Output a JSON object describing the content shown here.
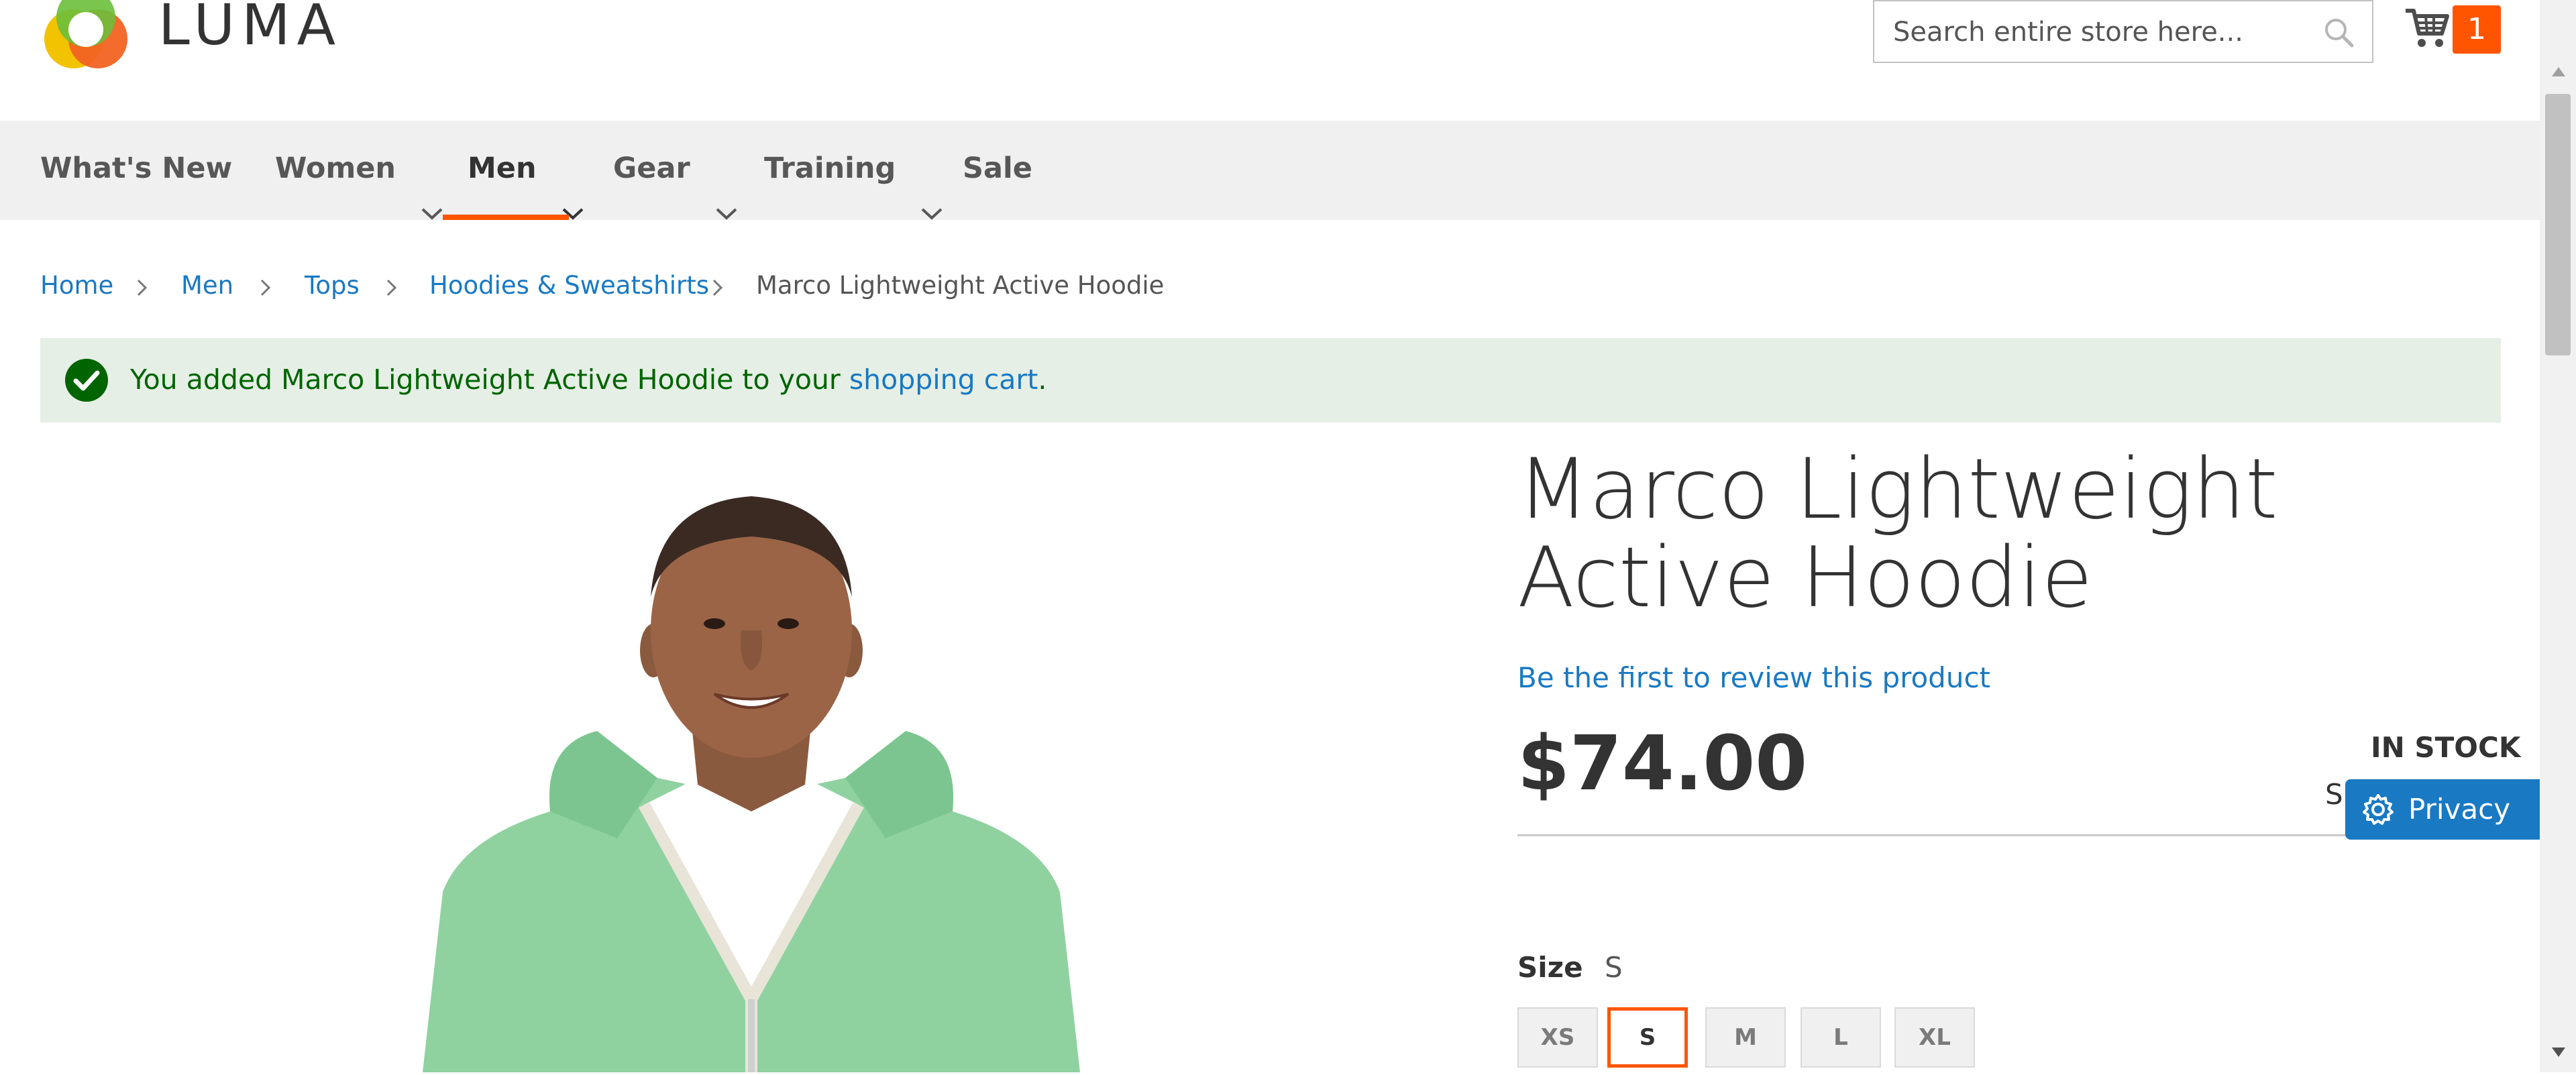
{
  "header": {
    "logo_text": "LUMA",
    "logo_icon": "luma-logo-icon",
    "search": {
      "placeholder": "Search entire store here...",
      "value": ""
    },
    "cart": {
      "icon": "cart-icon",
      "count": "1"
    }
  },
  "nav": {
    "items": [
      {
        "label": "What's New",
        "has_dropdown": false
      },
      {
        "label": "Women",
        "has_dropdown": true
      },
      {
        "label": "Men",
        "has_dropdown": true,
        "active": true
      },
      {
        "label": "Gear",
        "has_dropdown": true
      },
      {
        "label": "Training",
        "has_dropdown": true
      },
      {
        "label": "Sale",
        "has_dropdown": false
      }
    ],
    "accent_color": "#ff5501"
  },
  "breadcrumbs": [
    {
      "label": "Home",
      "link": true
    },
    {
      "label": "Men",
      "link": true
    },
    {
      "label": "Tops",
      "link": true
    },
    {
      "label": "Hoodies & Sweatshirts",
      "link": true
    },
    {
      "label": "Marco Lightweight Active Hoodie",
      "link": false
    }
  ],
  "message": {
    "prefix": "You added Marco Lightweight Active Hoodie to your ",
    "link_text": "shopping cart",
    "suffix": ".",
    "type": "success",
    "color": "#006400",
    "background": "#e5efe5"
  },
  "product": {
    "title": "Marco Lightweight Active Hoodie",
    "review_link": "Be the first to review this product",
    "price": "$74.00",
    "stock": "IN STOCK",
    "sku_partial": "S",
    "size": {
      "label": "Size",
      "selected": "S",
      "options": [
        "XS",
        "S",
        "M",
        "L",
        "XL"
      ]
    }
  },
  "privacy": {
    "label": "Privacy",
    "icon": "gear-icon",
    "color": "#1979c3"
  },
  "link_color": "#1979c3"
}
